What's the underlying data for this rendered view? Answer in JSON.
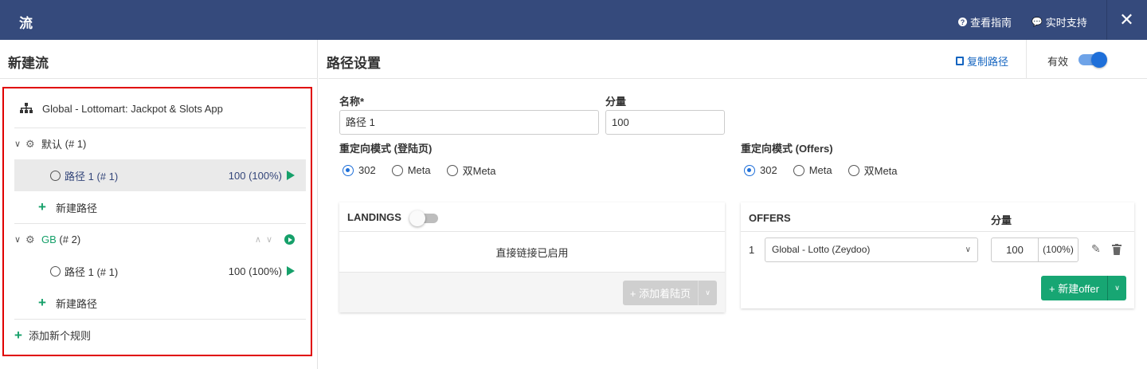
{
  "topbar": {
    "title": "流",
    "guide_label": "查看指南",
    "support_label": "实时支持",
    "close_label": "✕"
  },
  "left": {
    "heading": "新建流",
    "campaign": "Global - Lottomart: Jackpot & Slots App",
    "rules": [
      {
        "name": "默认",
        "index": "(# 1)",
        "paths": [
          {
            "name": "路径 1 (# 1)",
            "value": "100 (100%)"
          }
        ],
        "add_path": "新建路径"
      },
      {
        "name": "GB",
        "index": "(# 2)",
        "paths": [
          {
            "name": "路径 1 (# 1)",
            "value": "100 (100%)"
          }
        ],
        "add_path": "新建路径"
      }
    ],
    "add_rule": "添加新个规则"
  },
  "right": {
    "heading": "路径设置",
    "copy_path": "复制路径",
    "valid_label": "有效",
    "name_label": "名称*",
    "name_value": "路径 1",
    "weight_label": "分量",
    "weight_value": "100",
    "redirect_landing_label": "重定向模式 (登陆页)",
    "redirect_offers_label": "重定向模式 (Offers)",
    "redirect_options": [
      "302",
      "Meta",
      "双Meta"
    ],
    "landings": {
      "title": "LANDINGS",
      "direct_text": "直接链接已启用",
      "add_button": "+ 添加着陆页"
    },
    "offers": {
      "title": "OFFERS",
      "weight_header": "分量",
      "rows": [
        {
          "num": "1",
          "offer": "Global - Lotto (Zeydoo)",
          "weight": "100",
          "percent": "(100%)"
        }
      ],
      "new_button": "+ 新建offer"
    }
  }
}
